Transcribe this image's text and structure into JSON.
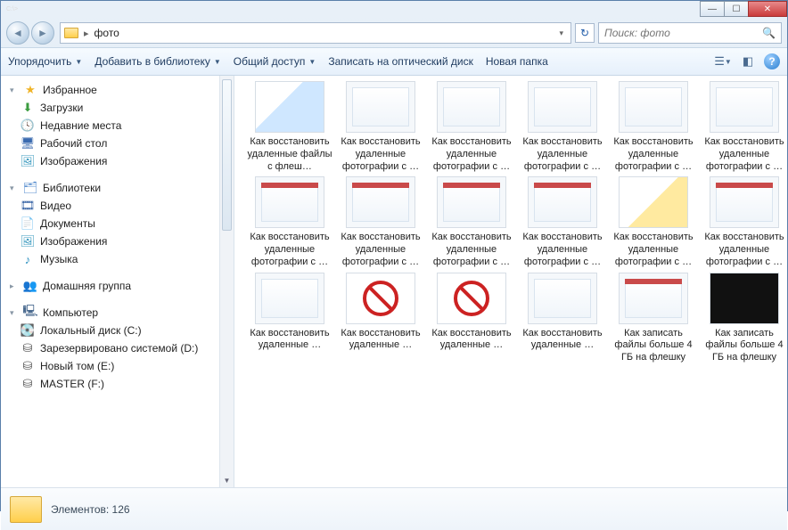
{
  "window": {
    "title": ""
  },
  "nav": {
    "path_label": "фото"
  },
  "search": {
    "placeholder": "Поиск: фото"
  },
  "toolbar": {
    "organize": "Упорядочить",
    "add_library": "Добавить в библиотеку",
    "share": "Общий доступ",
    "burn": "Записать на оптический диск",
    "new_folder": "Новая папка"
  },
  "sidebar": {
    "favorites": {
      "label": "Избранное",
      "items": [
        {
          "label": "Загрузки"
        },
        {
          "label": "Недавние места"
        },
        {
          "label": "Рабочий стол"
        },
        {
          "label": "Изображения"
        }
      ]
    },
    "libraries": {
      "label": "Библиотеки",
      "items": [
        {
          "label": "Видео"
        },
        {
          "label": "Документы"
        },
        {
          "label": "Изображения"
        },
        {
          "label": "Музыка"
        }
      ]
    },
    "homegroup": {
      "label": "Домашняя группа"
    },
    "computer": {
      "label": "Компьютер",
      "items": [
        {
          "label": "Локальный диск (C:)"
        },
        {
          "label": "Зарезервировано системой (D:)"
        },
        {
          "label": "Новый том (E:)"
        },
        {
          "label": "MASTER (F:)"
        }
      ]
    }
  },
  "files": {
    "row1": [
      {
        "label": "Как восстановить удаленные файлы с флеш…",
        "kind": "usb"
      },
      {
        "label": "Как восстановить удаленные фотографии с …",
        "kind": "shot"
      },
      {
        "label": "Как восстановить удаленные фотографии с …",
        "kind": "shot"
      },
      {
        "label": "Как восстановить удаленные фотографии с …",
        "kind": "shot"
      },
      {
        "label": "Как восстановить удаленные фотографии с …",
        "kind": "shot"
      },
      {
        "label": "Как восстановить удаленные фотографии с …",
        "kind": "shot"
      }
    ],
    "row2": [
      {
        "label": "Как восстановить удаленные фотографии с …",
        "kind": "shot redhdr"
      },
      {
        "label": "Как восстановить удаленные фотографии с …",
        "kind": "shot redhdr"
      },
      {
        "label": "Как восстановить удаленные фотографии с …",
        "kind": "shot redhdr"
      },
      {
        "label": "Как восстановить удаленные фотографии с …",
        "kind": "shot redhdr"
      },
      {
        "label": "Как восстановить удаленные фотографии с …",
        "kind": "yel"
      },
      {
        "label": "Как восстановить удаленные фотографии с …",
        "kind": "shot redhdr"
      }
    ],
    "row3": [
      {
        "label": "Как восстановить удаленные …",
        "kind": "shot"
      },
      {
        "label": "Как восстановить удаленные …",
        "kind": "no"
      },
      {
        "label": "Как восстановить удаленные …",
        "kind": "no"
      },
      {
        "label": "Как восстановить удаленные …",
        "kind": "shot"
      },
      {
        "label": "Как записать файлы больше 4 ГБ на флешку",
        "kind": "shot redhdr"
      },
      {
        "label": "Как записать файлы больше 4 ГБ на флешку",
        "kind": "cmd"
      }
    ]
  },
  "status": {
    "count_label": "Элементов: 126"
  }
}
